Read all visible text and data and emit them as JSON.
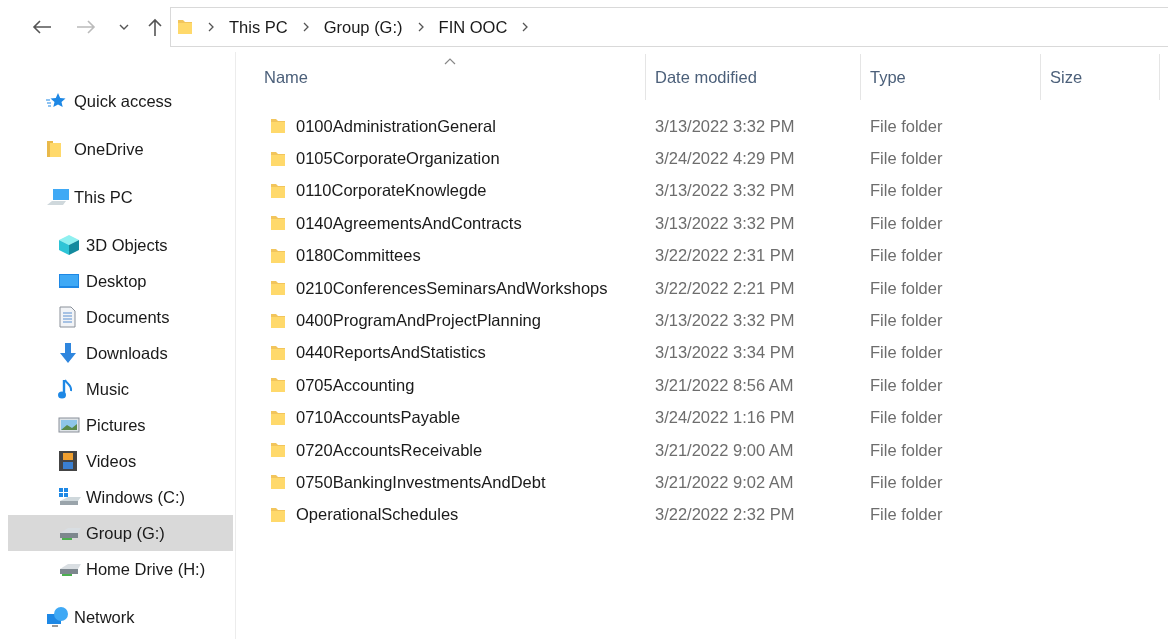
{
  "toolbar": {
    "breadcrumb": [
      "This PC",
      "Group (G:)",
      "FIN OOC"
    ]
  },
  "sidebar": {
    "items": [
      {
        "label": "Quick access",
        "kind": "star",
        "selected": false
      },
      {
        "label": "OneDrive",
        "kind": "folder",
        "selected": false
      },
      {
        "label": "This PC",
        "kind": "pc",
        "selected": false,
        "children": [
          {
            "label": "3D Objects",
            "kind": "cube",
            "selected": false
          },
          {
            "label": "Desktop",
            "kind": "desktop",
            "selected": false
          },
          {
            "label": "Documents",
            "kind": "document",
            "selected": false
          },
          {
            "label": "Downloads",
            "kind": "download",
            "selected": false
          },
          {
            "label": "Music",
            "kind": "music",
            "selected": false
          },
          {
            "label": "Pictures",
            "kind": "pictures",
            "selected": false
          },
          {
            "label": "Videos",
            "kind": "video",
            "selected": false
          },
          {
            "label": "Windows (C:)",
            "kind": "windows-drive",
            "selected": false
          },
          {
            "label": "Group (G:)",
            "kind": "drive",
            "selected": true
          },
          {
            "label": "Home Drive (H:)",
            "kind": "drive",
            "selected": false
          }
        ]
      },
      {
        "label": "Network",
        "kind": "network",
        "selected": false
      }
    ]
  },
  "table": {
    "columns": [
      "Name",
      "Date modified",
      "Type",
      "Size"
    ],
    "rows": [
      [
        "0100AdministrationGeneral",
        "3/13/2022 3:32 PM",
        "File folder"
      ],
      [
        "0105CorporateOrganization",
        "3/24/2022 4:29 PM",
        "File folder"
      ],
      [
        "0110CorporateKnowlegde",
        "3/13/2022 3:32 PM",
        "File folder"
      ],
      [
        "0140AgreementsAndContracts",
        "3/13/2022 3:32 PM",
        "File folder"
      ],
      [
        "0180Committees",
        "3/22/2022 2:31 PM",
        "File folder"
      ],
      [
        "0210ConferencesSeminarsAndWorkshops",
        "3/22/2022 2:21 PM",
        "File folder"
      ],
      [
        "0400ProgramAndProjectPlanning",
        "3/13/2022 3:32 PM",
        "File folder"
      ],
      [
        "0440ReportsAndStatistics",
        "3/13/2022 3:34 PM",
        "File folder"
      ],
      [
        "0705Accounting",
        "3/21/2022 8:56 AM",
        "File folder"
      ],
      [
        "0710AccountsPayable",
        "3/24/2022 1:16 PM",
        "File folder"
      ],
      [
        "0720AccountsReceivable",
        "3/21/2022 9:00 AM",
        "File folder"
      ],
      [
        "0750BankingInvestmentsAndDebt",
        "3/21/2022 9:02 AM",
        "File folder"
      ],
      [
        "OperationalSchedules",
        "3/22/2022 2:32 PM",
        "File folder"
      ]
    ]
  }
}
